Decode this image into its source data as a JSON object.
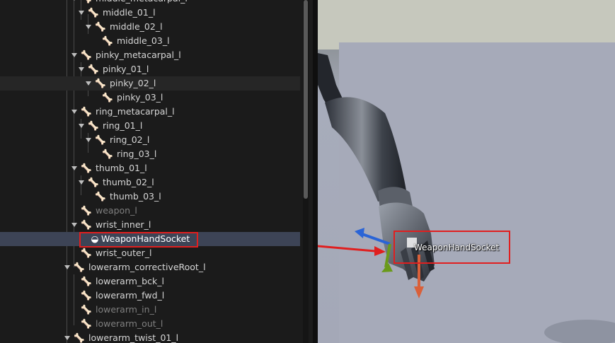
{
  "hierarchy": {
    "items": [
      {
        "label": "middle_metacarpal_l"
      },
      {
        "label": "middle_01_l"
      },
      {
        "label": "middle_02_l"
      },
      {
        "label": "middle_03_l"
      },
      {
        "label": "pinky_metacarpal_l"
      },
      {
        "label": "pinky_01_l"
      },
      {
        "label": "pinky_02_l"
      },
      {
        "label": "pinky_03_l"
      },
      {
        "label": "ring_metacarpal_l"
      },
      {
        "label": "ring_01_l"
      },
      {
        "label": "ring_02_l"
      },
      {
        "label": "ring_03_l"
      },
      {
        "label": "thumb_01_l"
      },
      {
        "label": "thumb_02_l"
      },
      {
        "label": "thumb_03_l"
      },
      {
        "label": "weapon_l"
      },
      {
        "label": "wrist_inner_l"
      },
      {
        "label": "WeaponHandSocket"
      },
      {
        "label": "wrist_outer_l"
      },
      {
        "label": "lowerarm_correctiveRoot_l"
      },
      {
        "label": "lowerarm_bck_l"
      },
      {
        "label": "lowerarm_fwd_l"
      },
      {
        "label": "lowerarm_in_l"
      },
      {
        "label": "lowerarm_out_l"
      },
      {
        "label": "lowerarm_twist_01_l"
      }
    ]
  },
  "viewport": {
    "socket_label": "WeaponHandSocket"
  },
  "colors": {
    "annotation_red": "#e01f1f",
    "selection": "#3d4456",
    "gizmo_x": "#2a64d6",
    "gizmo_y": "#6a9a1a",
    "gizmo_z": "#d9603a"
  },
  "icons": {
    "bone": "bone-icon",
    "socket": "socket-icon",
    "expand": "expand-arrow-icon"
  }
}
